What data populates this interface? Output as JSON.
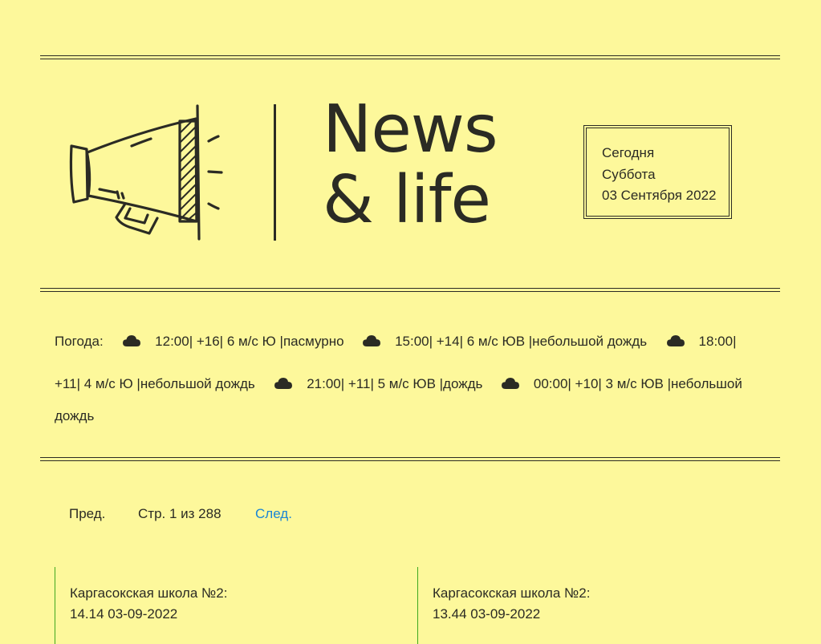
{
  "header": {
    "title_line1": "News",
    "title_line2": "& life",
    "date_box": {
      "today": "Сегодня",
      "weekday": "Суббота",
      "date": "03 Сентября 2022"
    }
  },
  "weather": {
    "label": "Погода:",
    "line1": [
      "12:00| +16| 6 м/с Ю |пасмурно",
      "15:00| +14| 6 м/с ЮВ |небольшой дождь",
      "18:00|"
    ],
    "line2_start": "+11| 4 м/с Ю |небольшой дождь",
    "line2": [
      "21:00| +11| 5 м/с ЮВ |дождь",
      "00:00| +10| 3 м/с ЮВ |небольшой"
    ],
    "line3": "дождь",
    "icon": "cloud-icon"
  },
  "pagination": {
    "prev": "Пред.",
    "status": "Стр. 1 из 288",
    "next": "След."
  },
  "colors": {
    "background": "#fdf89b",
    "text": "#2b2b24",
    "link": "#1a86d6",
    "card_border": "#3fa81f"
  },
  "news": [
    {
      "source": "Каргасокская школа №2:",
      "datetime": "14.14 03-09-2022"
    },
    {
      "source": "Каргасокская школа №2:",
      "datetime": "13.44 03-09-2022"
    }
  ]
}
